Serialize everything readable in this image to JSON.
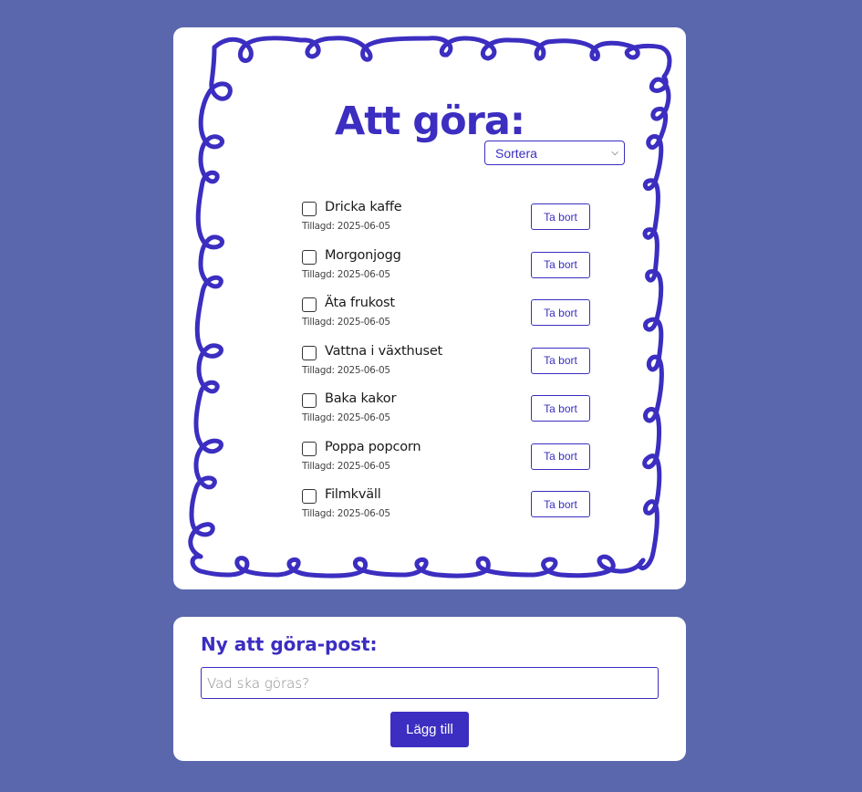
{
  "todo": {
    "title": "Att göra:",
    "sort_label": "Sortera",
    "delete_label": "Ta bort",
    "items": [
      {
        "text": "Dricka kaffe",
        "date": "Tillagd: 2025-06-05"
      },
      {
        "text": "Morgonjogg",
        "date": "Tillagd: 2025-06-05"
      },
      {
        "text": "Äta frukost",
        "date": "Tillagd: 2025-06-05"
      },
      {
        "text": "Vattna i växthuset",
        "date": "Tillagd: 2025-06-05"
      },
      {
        "text": "Baka kakor",
        "date": "Tillagd: 2025-06-05"
      },
      {
        "text": "Poppa popcorn",
        "date": "Tillagd: 2025-06-05"
      },
      {
        "text": "Filmkväll",
        "date": "Tillagd: 2025-06-05"
      }
    ]
  },
  "new_item": {
    "title": "Ny att göra-post:",
    "placeholder": "Vad ska göras?",
    "value": "",
    "add_label": "Lägg till"
  },
  "colors": {
    "background": "#5a67ad",
    "accent": "#3b2ec0",
    "card": "#ffffff"
  }
}
